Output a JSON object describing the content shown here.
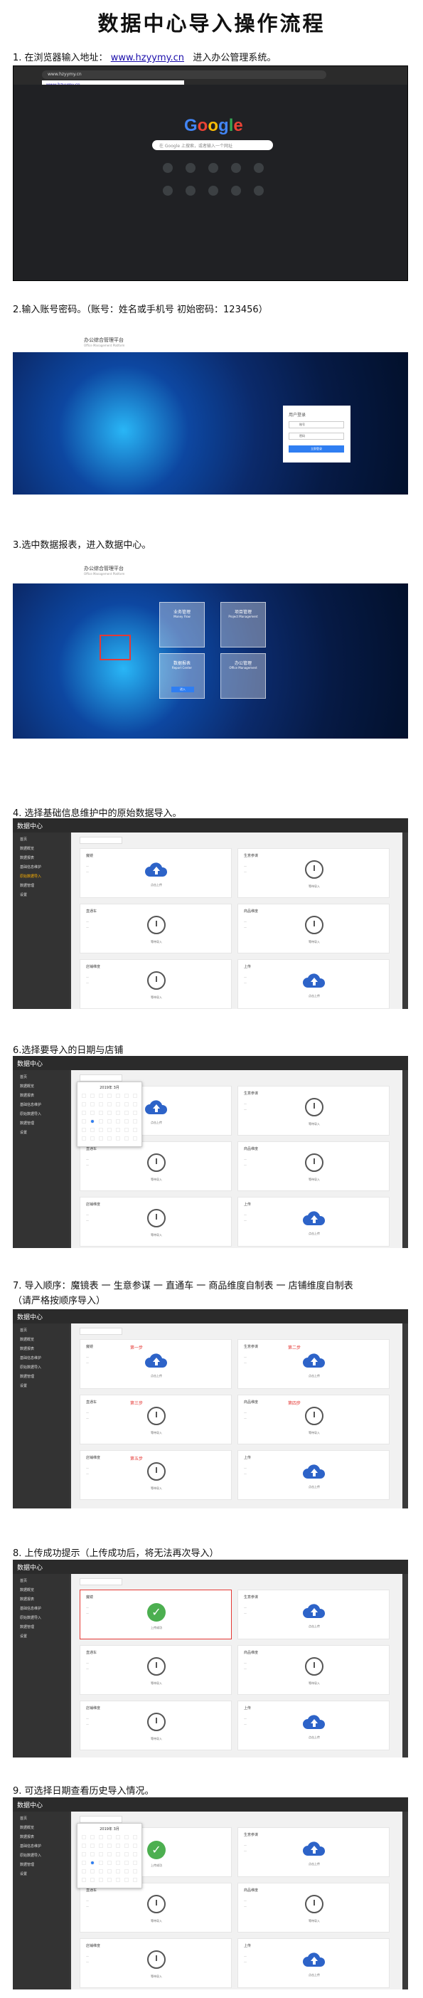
{
  "title": "数据中心导入操作流程",
  "steps": [
    {
      "num": "1.",
      "text_before": "在浏览器输入地址：",
      "link": "www.hzyymy.cn",
      "text_after": "进入办公管理系统。"
    },
    {
      "text": "2.输入账号密码。（账号：姓名或手机号    初始密码：123456）"
    },
    {
      "text": "3.选中数据报表，进入数据中心。"
    },
    {
      "text": "4.  选择基础信息维护中的原始数据导入。"
    },
    {
      "text": "6.选择要导入的日期与店铺"
    },
    {
      "line1": "7.  导入顺序：魔镜表 一 生意参谋 一 直通车 一 商品维度自制表 一 店铺维度自制表",
      "line2": "（请严格按顺序导入）"
    },
    {
      "text": "8.  上传成功提示（上传成功后，将无法再次导入）"
    },
    {
      "text": "9.  可选择日期查看历史导入情况。"
    }
  ],
  "browser": {
    "logo": "Google",
    "search_placeholder": "在 Google 上搜索，或者输入一个网址",
    "address": "www.hzyymy.cn",
    "suggestion": "www.hzyymy.cn"
  },
  "login": {
    "brand": "办公综合管理平台",
    "brand_sub": "Office Management Platform",
    "panel_title": "用户登录",
    "username_value": "账号",
    "password_value": "密码",
    "submit": "立即登录"
  },
  "portal": {
    "brand": "办公综合管理平台",
    "brand_sub": "Office Management Platform",
    "tiles": [
      "业务管理",
      "项目管理",
      "数据报表",
      "办公管理"
    ],
    "tile_subs": [
      "Money Flow",
      "Project Management",
      "Report Center",
      "Office Management"
    ],
    "enter": "进入"
  },
  "app": {
    "header": "数据中心",
    "sidebar": [
      "首页",
      "数据概览",
      "数据报表",
      "基础信息维护",
      "原始数据导入",
      "数据管理",
      "设置"
    ],
    "cards": [
      "魔镜",
      "生意参谋",
      "直通车",
      "商品维度",
      "店铺维度",
      "上传"
    ],
    "upload_caption": "点击上传",
    "waiting_caption": "等待导入",
    "success_caption": "上传成功",
    "calendar_title": "2019年 3月",
    "order_labels": [
      "第一步",
      "第二步",
      "第三步",
      "第四步",
      "第五步"
    ]
  },
  "colors": {
    "accent": "#1a0dab",
    "cloud": "#2d63c8",
    "success": "#4caf50",
    "highlight": "#e53935"
  }
}
